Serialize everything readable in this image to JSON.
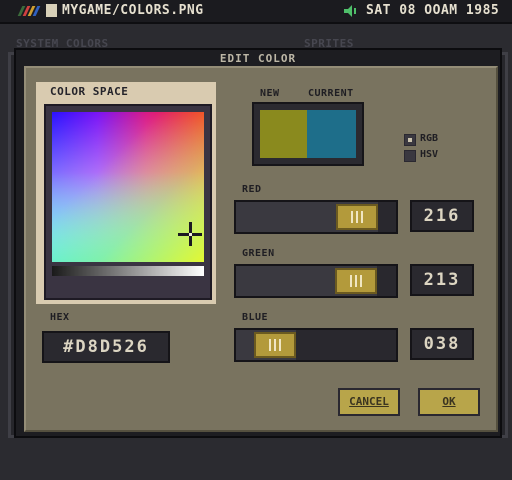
{
  "topbar": {
    "file_path": "MYGAME/COLORS.PNG",
    "clock": "SAT 08 OOAM 1985",
    "logo_colors": [
      "#3b6b3b",
      "#d04040",
      "#d0a030",
      "#3060c0"
    ]
  },
  "background": {
    "left_panel_label": "SYSTEM COLORS",
    "right_panel_label": "SPRITES"
  },
  "dialog": {
    "title": "EDIT COLOR",
    "color_space_label": "COLOR SPACE",
    "preview": {
      "new_label": "NEW",
      "current_label": "CURRENT",
      "new_color": "#8a8a1e",
      "current_color": "#1e6e8a"
    },
    "mode": {
      "options": [
        "RGB",
        "HSV"
      ],
      "selected": "RGB"
    },
    "red": {
      "label": "RED",
      "value": "216",
      "fraction": 0.847
    },
    "green": {
      "label": "GREEN",
      "value": "213",
      "fraction": 0.835
    },
    "blue": {
      "label": "BLUE",
      "value": "038",
      "fraction": 0.149
    },
    "hex": {
      "label": "HEX",
      "value": "#D8D526"
    },
    "buttons": {
      "cancel": "CANCEL",
      "ok": "OK"
    }
  }
}
